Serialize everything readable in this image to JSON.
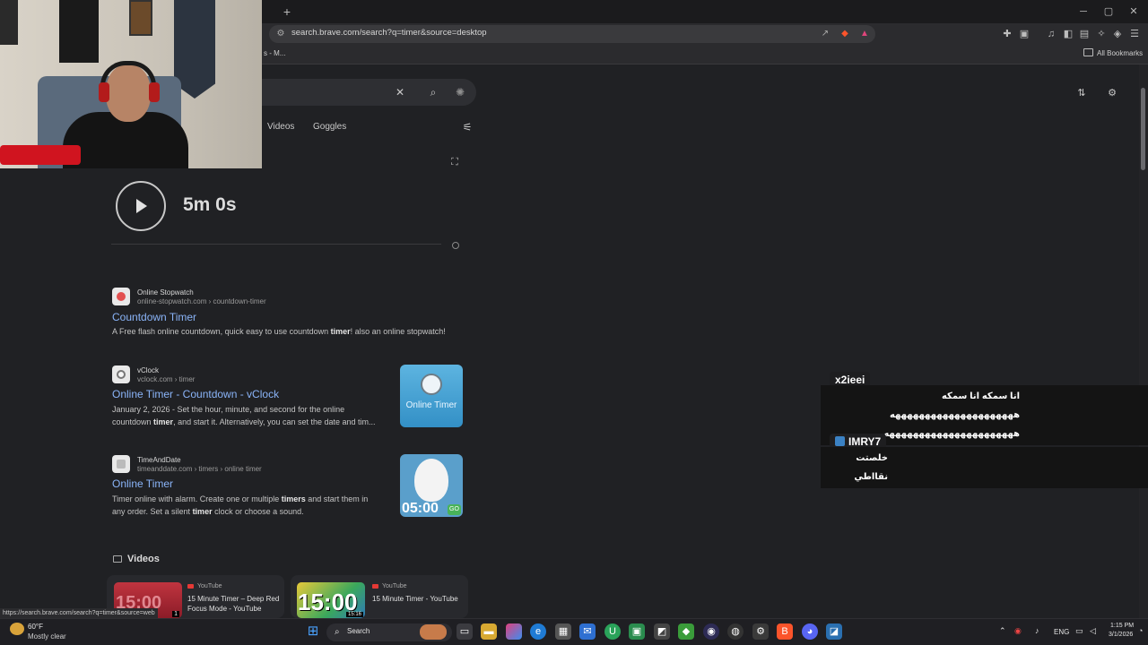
{
  "browser": {
    "new_tab": "+",
    "url": "search.brave.com/search?q=timer&source=desktop",
    "bookmark_partial": "s - M...",
    "all_bookmarks": "All Bookmarks",
    "win_minimize": "─",
    "win_maximize": "▢",
    "win_close": "✕"
  },
  "search": {
    "tabs": [
      "Videos",
      "Goggles"
    ]
  },
  "timer": {
    "value": "5m 0s"
  },
  "results": [
    {
      "site": "Online Stopwatch",
      "url": "online-stopwatch.com › countdown-timer",
      "title": "Countdown Timer",
      "desc_pre": "A Free flash online countdown, quick easy to use countdown ",
      "desc_bold": "timer",
      "desc_post": "! also an online stopwatch!"
    },
    {
      "site": "vClock",
      "url": "vclock.com › timer",
      "title": "Online Timer - Countdown - vClock",
      "desc_line1": "January 2, 2026 - Set the hour, minute, and second for the online",
      "desc_line2_pre": "countdown ",
      "desc_line2_bold": "timer",
      "desc_line2_post": ", and start it. Alternatively, you can set the date and tim...",
      "thumb_label": "Online Timer"
    },
    {
      "site": "TimeAndDate",
      "url": "timeanddate.com › timers › online timer",
      "title": "Online Timer",
      "desc_line1_pre": "Timer online with alarm. Create one or multiple ",
      "desc_line1_bold": "timers",
      "desc_line1_post": " and start them in",
      "desc_line2_pre": "any order. Set a silent ",
      "desc_line2_bold": "timer",
      "desc_line2_post": " clock or choose a sound.",
      "thumb_time": "05:00",
      "thumb_go": "GO"
    }
  ],
  "videos": {
    "heading": "Videos",
    "items": [
      {
        "source": "YouTube",
        "title": "15 Minute Timer – Deep Red Focus Mode - YouTube",
        "thumb_text": "15:00",
        "badge": "1"
      },
      {
        "source": "YouTube",
        "title": "15 Minute Timer - YouTube",
        "thumb_text": "15:00",
        "badge": "15:16"
      }
    ]
  },
  "chat": [
    {
      "user": "x2ieei",
      "lines": [
        "انا سمكه انا سمكه هههههههههههههههههههههه",
        "ههههههههههههههههههههههه"
      ]
    },
    {
      "user": "IMRY7",
      "lines": [
        "خلصتت نقااطي"
      ]
    }
  ],
  "status_url": "https://search.brave.com/search?q=timer&source=web",
  "taskbar": {
    "weather_temp": "60°F",
    "weather_desc": "Mostly clear",
    "search_label": "Search",
    "lang": "ENG",
    "time": "1:15 PM",
    "date": "3/1/2026"
  },
  "colors": {
    "link": "#8ab4f8",
    "background": "#202124",
    "brave_orange": "#fb542b"
  }
}
